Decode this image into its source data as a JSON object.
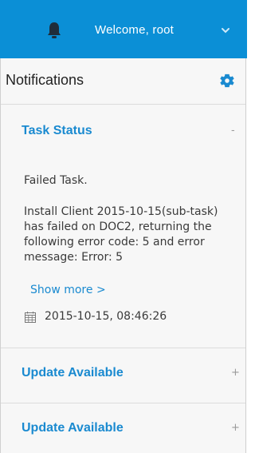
{
  "header": {
    "welcome_text": "Welcome, root"
  },
  "notifications": {
    "title": "Notifications",
    "items": [
      {
        "title": "Task Status",
        "toggle": "-",
        "status": "Failed Task.",
        "message": "Install Client 2015-10-15(sub-task) has failed on DOC2, returning the following error code: 5 and error message: Error: 5",
        "show_more": "Show more >",
        "datetime": "2015-10-15, 08:46:26"
      },
      {
        "title": "Update Available",
        "toggle": "+"
      },
      {
        "title": "Update Available",
        "toggle": "+"
      }
    ]
  },
  "colors": {
    "header_bg": "#0b8fd6",
    "accent": "#1a8ad0",
    "panel_bg": "#f7f7f7"
  },
  "icons": [
    "bell-icon",
    "chevron-down-icon",
    "gear-icon",
    "calendar-icon"
  ]
}
